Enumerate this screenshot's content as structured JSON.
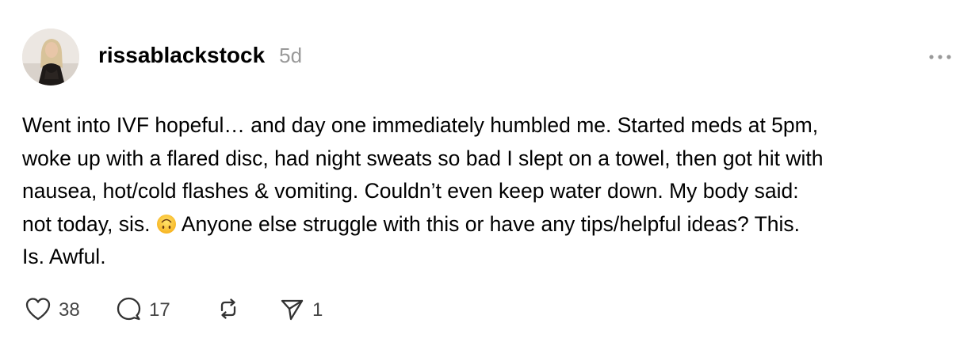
{
  "post": {
    "username": "rissablackstock",
    "timestamp": "5d",
    "text_part1": "Went into IVF hopeful… and day one immediately humbled me. Started meds at 5pm,\nwoke up with a flared disc, had night sweats so bad I slept on a towel, then got hit with\nnausea, hot/cold flashes & vomiting. Couldn’t even keep water down. My body said:\nnot today, sis. ",
    "text_part2": " Anyone else struggle with this or have any tips/helpful ideas? This.\nIs. Awful.",
    "emoji_icon": "upside-down-face-emoji-icon"
  },
  "actions": {
    "likes": "38",
    "comments": "17",
    "shares": "1",
    "like_icon": "heart-icon",
    "comment_icon": "speech-bubble-icon",
    "repost_icon": "repost-icon",
    "share_icon": "paper-plane-icon",
    "more_icon": "ellipsis-icon"
  },
  "colors": {
    "text": "#000000",
    "muted": "#999999",
    "icon": "#333333"
  }
}
